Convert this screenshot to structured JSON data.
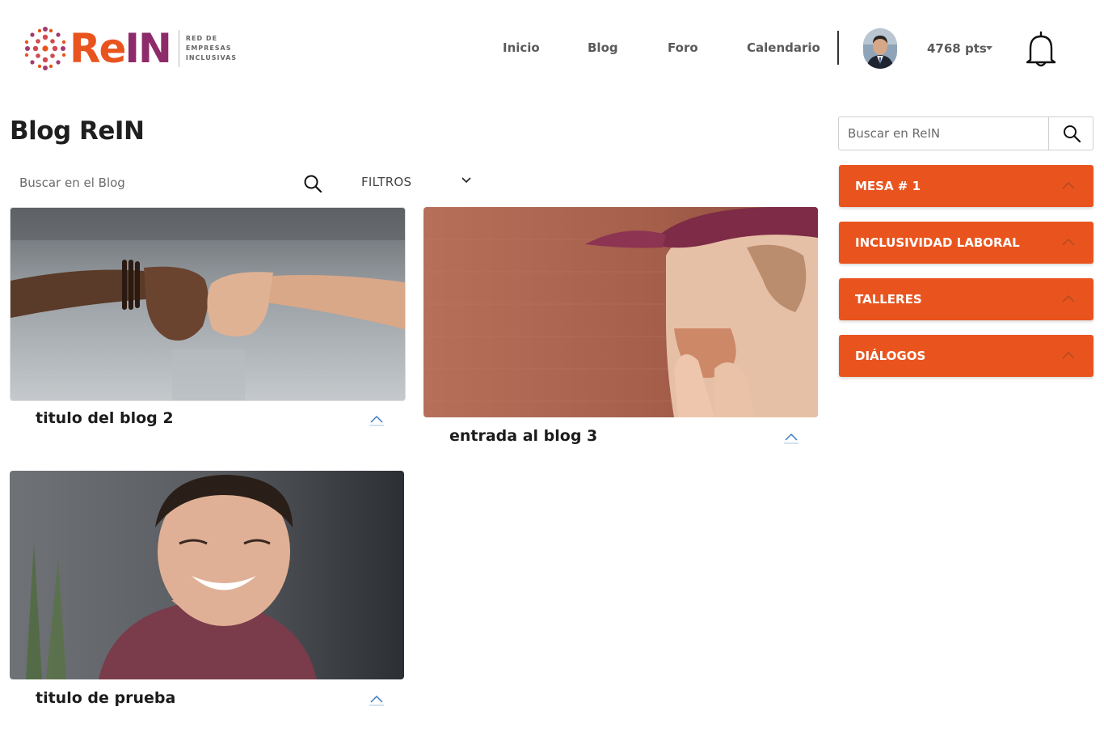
{
  "brand": {
    "name_part1": "Re",
    "name_part2": "IN",
    "tagline": "RED DE\nEMPRESAS\nINCLUSIVAS",
    "color_orange": "#e9541e",
    "color_purple": "#8e2b6a"
  },
  "nav": {
    "items": [
      "Inicio",
      "Blog",
      "Foro",
      "Calendario"
    ]
  },
  "user": {
    "points": "4768 pts",
    "avatar_icon": "user-avatar",
    "notifications_icon": "bell-icon"
  },
  "page": {
    "title": "Blog ReIN"
  },
  "blog_search": {
    "placeholder": "Buscar en el Blog",
    "icon": "search-icon"
  },
  "filters": {
    "label": "FILTROS",
    "icon": "chevron-down-icon"
  },
  "posts": [
    {
      "title": "titulo del blog 2",
      "image": "fist-bump-photo"
    },
    {
      "title": "entrada al blog 3",
      "image": "laughing-man-cap-photo"
    },
    {
      "title": "titulo de prueba",
      "image": "smiling-man-photo"
    }
  ],
  "sidebar": {
    "search_placeholder": "Buscar en ReIN",
    "categories": [
      "MESA # 1",
      "INCLUSIVIDAD LABORAL",
      "TALLERES",
      "DIÁLOGOS"
    ],
    "category_color": "#e9541e"
  }
}
